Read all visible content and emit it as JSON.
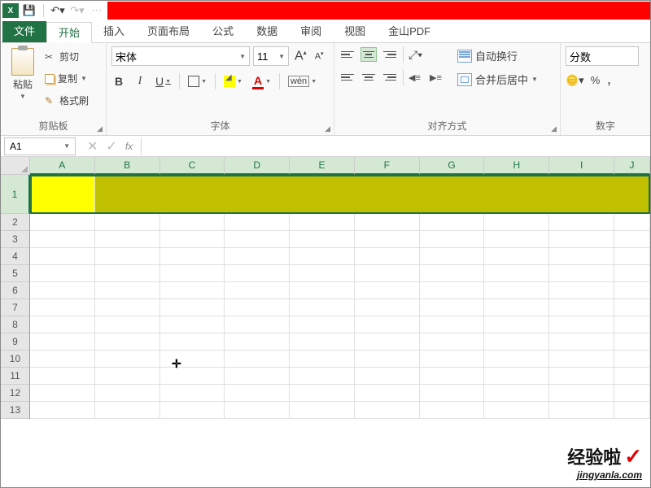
{
  "qat": {
    "save": "save",
    "undo": "undo",
    "redo": "redo"
  },
  "tabs": {
    "file": "文件",
    "home": "开始",
    "insert": "插入",
    "layout": "页面布局",
    "formulas": "公式",
    "data": "数据",
    "review": "审阅",
    "view": "视图",
    "pdf": "金山PDF"
  },
  "ribbon": {
    "clipboard": {
      "label": "剪贴板",
      "paste": "粘贴",
      "cut": "剪切",
      "copy": "复制",
      "format_painter": "格式刷"
    },
    "font": {
      "label": "字体",
      "name": "宋体",
      "size": "11",
      "bold": "B",
      "italic": "I",
      "underline": "U",
      "fontcolor": "A",
      "wen": "wén"
    },
    "align": {
      "label": "对齐方式",
      "wrap": "自动换行",
      "merge": "合并后居中"
    },
    "number": {
      "label": "数字",
      "format": "分数",
      "percent": "%",
      "comma": "，"
    }
  },
  "formula_bar": {
    "name_box": "A1",
    "fx": "fx"
  },
  "grid": {
    "columns": [
      "A",
      "B",
      "C",
      "D",
      "E",
      "F",
      "G",
      "H",
      "I",
      "J"
    ],
    "rows": [
      "1",
      "2",
      "3",
      "4",
      "5",
      "6",
      "7",
      "8",
      "9",
      "10",
      "11",
      "12",
      "13"
    ],
    "selected_cell": "A1",
    "row1_fill": {
      "A": "#ffff00",
      "rest": "#c0c000"
    }
  },
  "watermark": {
    "text": "经验啦",
    "check": "✓",
    "url": "jingyanla.com"
  }
}
